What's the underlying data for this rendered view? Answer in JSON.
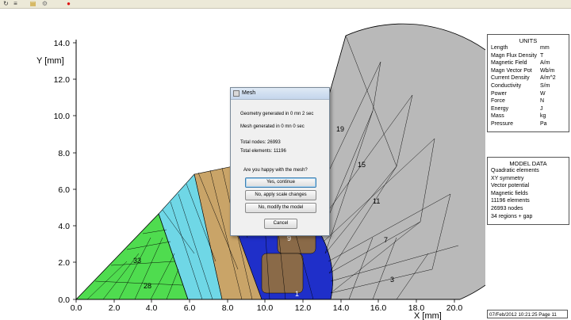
{
  "toolbar": {
    "icons": [
      "refresh-icon",
      "stack-icon",
      "folder-open-icon",
      "gear-icon",
      "record-icon"
    ]
  },
  "plot": {
    "y_axis_label": "Y [mm]",
    "x_axis_label": "X [mm]",
    "y_ticks": [
      "14.0",
      "12.0",
      "10.0",
      "8.0",
      "6.0",
      "4.0",
      "2.0",
      "0.0"
    ],
    "x_ticks": [
      "0.0",
      "2.0",
      "4.0",
      "6.0",
      "8.0",
      "10.0",
      "12.0",
      "14.0",
      "16.0",
      "18.0",
      "20.0"
    ],
    "region_labels": [
      "19",
      "15",
      "11",
      "7",
      "3",
      "33",
      "28",
      "9",
      "1"
    ],
    "colors": {
      "green": "#4fdc4f",
      "cyan": "#6fd7e6",
      "gold": "#c9a468",
      "blue": "#1f2fc9",
      "gray": "#b9b9b9"
    }
  },
  "units_panel": {
    "title": "UNITS",
    "rows": [
      {
        "name": "Length",
        "unit": "mm"
      },
      {
        "name": "Magn Flux Density",
        "unit": "T"
      },
      {
        "name": "Magnetic Field",
        "unit": "A/m"
      },
      {
        "name": "Magn Vector Pot",
        "unit": "Wb/m"
      },
      {
        "name": "Current Density",
        "unit": "A/m^2"
      },
      {
        "name": "Conductivity",
        "unit": "S/m"
      },
      {
        "name": "Power",
        "unit": "W"
      },
      {
        "name": "Force",
        "unit": "N"
      },
      {
        "name": "Energy",
        "unit": "J"
      },
      {
        "name": "Mass",
        "unit": "kg"
      },
      {
        "name": "Pressure",
        "unit": "Pa"
      }
    ]
  },
  "model_panel": {
    "title": "MODEL DATA",
    "lines": [
      "Quadratic elements",
      "XY symmetry",
      "Vector potential",
      "Magnetic fields",
      "11196 elements",
      "26993 nodes",
      "34 regions + gap"
    ]
  },
  "status_bar": {
    "text": "07/Feb/2012 10:21:25 Page 11"
  },
  "dialog": {
    "title": "Mesh",
    "geometry_text": "Geometry generated in 0 mn 2 sec",
    "mesh_text": "Mesh generated in 0 mn 0 sec",
    "nodes_text": "Total nodes: 26993",
    "elements_text": "Total elements: 11196",
    "question": "Are you happy with the mesh?",
    "btn_continue": "Yes, continue",
    "btn_scale": "No, apply scale changes",
    "btn_modify": "No, modify the model",
    "btn_cancel": "Cancel"
  }
}
